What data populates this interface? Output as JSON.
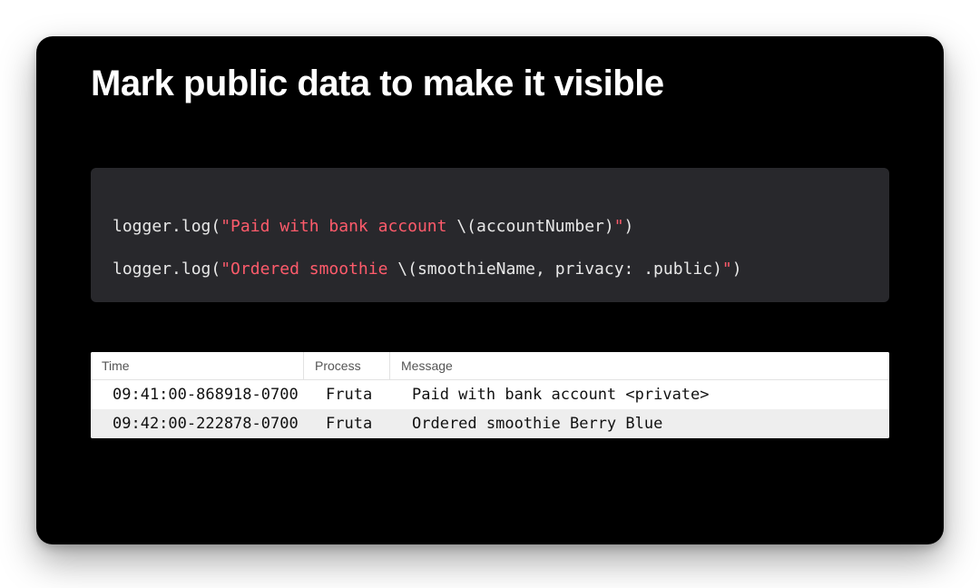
{
  "title": "Mark public data to make it visible",
  "code": {
    "line1": {
      "prefix": "logger.log(",
      "str_open": "\"Paid with bank account ",
      "interp": "\\(accountNumber)",
      "str_close": "\"",
      "suffix": ")"
    },
    "line2": {
      "prefix": "logger.log(",
      "str_open": "\"Ordered smoothie ",
      "interp": "\\(smoothieName, privacy: .public)",
      "str_close": "\"",
      "suffix": ")"
    }
  },
  "log": {
    "headers": {
      "time": "Time",
      "process": "Process",
      "message": "Message"
    },
    "rows": [
      {
        "time": "09:41:00-868918-0700",
        "process": "Fruta",
        "message": "Paid with bank account <private>"
      },
      {
        "time": "09:42:00-222878-0700",
        "process": "Fruta",
        "message": "Ordered smoothie Berry Blue"
      }
    ]
  }
}
